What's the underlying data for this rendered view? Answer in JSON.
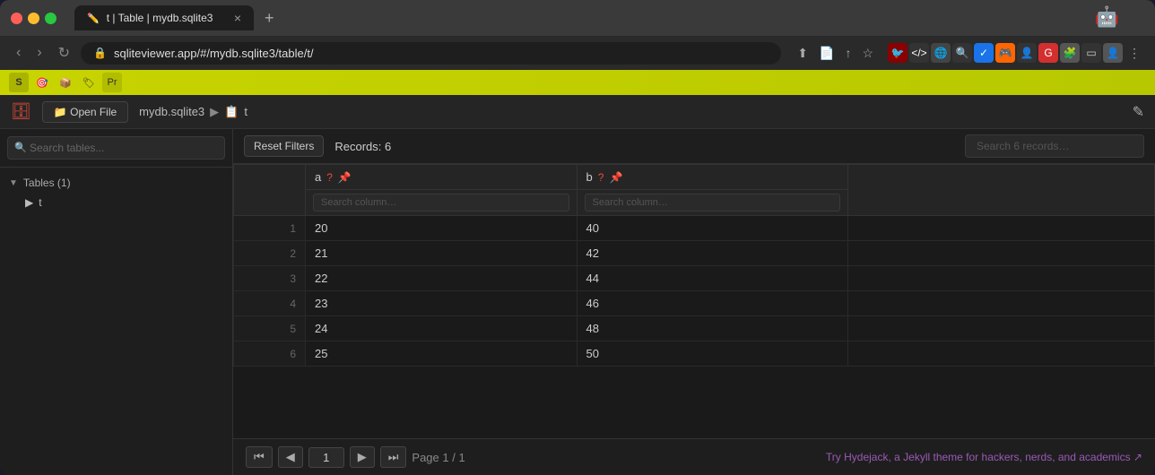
{
  "browser": {
    "tab_label": "t | Table | mydb.sqlite3",
    "tab_close": "×",
    "tab_new": "+",
    "address": "sqliteviewer.app/#/mydb.sqlite3/table/t/",
    "android_icon": "🤖"
  },
  "app": {
    "header": {
      "open_file_label": "📁 Open File",
      "breadcrumb": {
        "db": "mydb.sqlite3",
        "separator": "▶",
        "table": "t"
      },
      "edit_icon": "✎"
    },
    "sidebar": {
      "search_placeholder": "Search tables...",
      "tables_group": "Tables (1)",
      "tables": [
        {
          "name": "t",
          "icon": "▶"
        }
      ]
    },
    "toolbar": {
      "reset_filters": "Reset Filters",
      "records_count": "Records: 6",
      "search_placeholder": "Search 6 records…"
    },
    "table": {
      "columns": [
        {
          "name": "a",
          "has_info": true,
          "has_pin": true,
          "search_placeholder": "Search column…"
        },
        {
          "name": "b",
          "has_info": true,
          "has_pin": true,
          "search_placeholder": "Search column…"
        }
      ],
      "rows": [
        {
          "num": 1,
          "a": "20",
          "b": "40"
        },
        {
          "num": 2,
          "a": "21",
          "b": "42"
        },
        {
          "num": 3,
          "a": "22",
          "b": "44"
        },
        {
          "num": 4,
          "a": "23",
          "b": "46"
        },
        {
          "num": 5,
          "a": "24",
          "b": "48"
        },
        {
          "num": 6,
          "a": "25",
          "b": "50"
        }
      ]
    },
    "pagination": {
      "page_value": "1",
      "page_info": "Page 1 / 1",
      "hydejack_text": "Try Hydejack, a Jekyll theme for hackers, nerds, and academics ↗"
    }
  }
}
